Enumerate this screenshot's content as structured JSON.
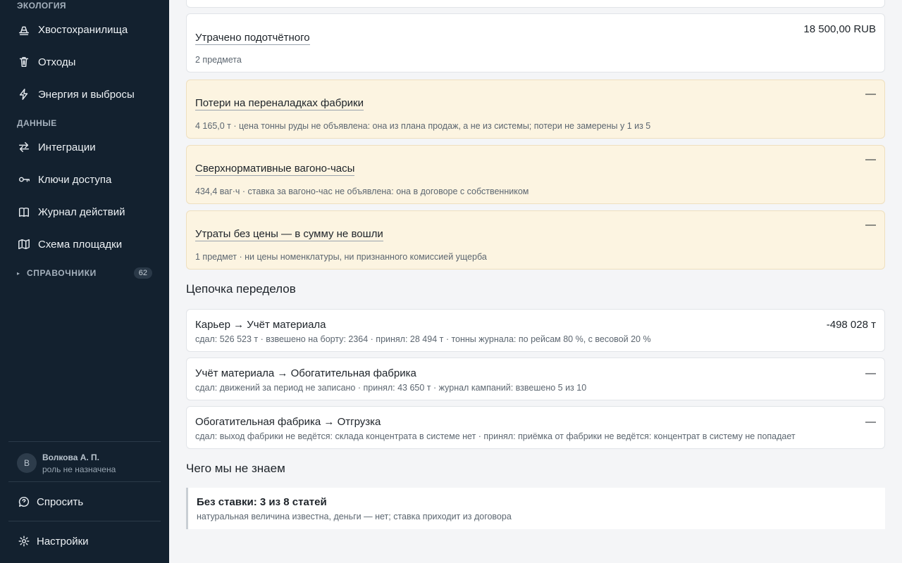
{
  "sidebar": {
    "section_ecology": "ЭКОЛОГИЯ",
    "ecology_items": [
      {
        "label": "Хвостохранилища",
        "icon": "tailings-icon"
      },
      {
        "label": "Отходы",
        "icon": "trash-icon"
      },
      {
        "label": "Энергия и выбросы",
        "icon": "bolt-icon"
      }
    ],
    "section_data": "ДАННЫЕ",
    "data_items": [
      {
        "label": "Интеграции",
        "icon": "arrows-swap-icon"
      },
      {
        "label": "Ключи доступа",
        "icon": "key-icon"
      },
      {
        "label": "Журнал действий",
        "icon": "book-icon"
      },
      {
        "label": "Схема площадки",
        "icon": "map-icon"
      }
    ],
    "references": {
      "label": "СПРАВОЧНИКИ",
      "count": "62"
    },
    "user": {
      "initial": "В",
      "name": "Волкова А. П.",
      "role": "роль не назначена"
    },
    "ask_label": "Спросить",
    "settings_label": "Настройки"
  },
  "losses": [
    {
      "title": "Утрачено подотчётного",
      "value": "18 500,00 RUB",
      "sub": "2 предмета",
      "warn": false
    },
    {
      "title": "Потери на переналадках фабрики",
      "value": "—",
      "sub": "4 165,0 т · цена тонны руды не объявлена: она из плана продаж, а не из системы; потери не замерены у 1 из 5",
      "warn": true
    },
    {
      "title": "Сверхнормативные вагоно-часы",
      "value": "—",
      "sub": "434,4 ваг·ч · ставка за вагоно-час не объявлена: она в договоре с собственником",
      "warn": true
    },
    {
      "title": "Утраты без цены — в сумму не вошли",
      "value": "—",
      "sub": "1 предмет · ни цены номенклатуры, ни признанного комиссией ущерба",
      "warn": true
    }
  ],
  "chain": {
    "heading": "Цепочка переделов",
    "items": [
      {
        "title": "Карьер → Учёт материала",
        "value": "-498 028 т",
        "sub": "сдал: 526 523 т · взвешено на борту: 2364 · принял: 28 494 т · тонны журнала: по рейсам 80 %, с весовой 20 %"
      },
      {
        "title": "Учёт материала → Обогатительная фабрика",
        "value": "—",
        "sub": "сдал: движений за период не записано · принял: 43 650 т · журнал кампаний: взвешено 5 из 10"
      },
      {
        "title": "Обогатительная фабрика → Отгрузка",
        "value": "—",
        "sub": "сдал: выход фабрики не ведётся: склада концентрата в системе нет · принял: приёмка от фабрики не ведётся: концентрат в систему не попадает"
      }
    ]
  },
  "unknowns": {
    "heading": "Чего мы не знаем",
    "title": "Без ставки: 3 из 8 статей",
    "sub": "натуральная величина известна, деньги — нет; ставка приходит из договора"
  }
}
